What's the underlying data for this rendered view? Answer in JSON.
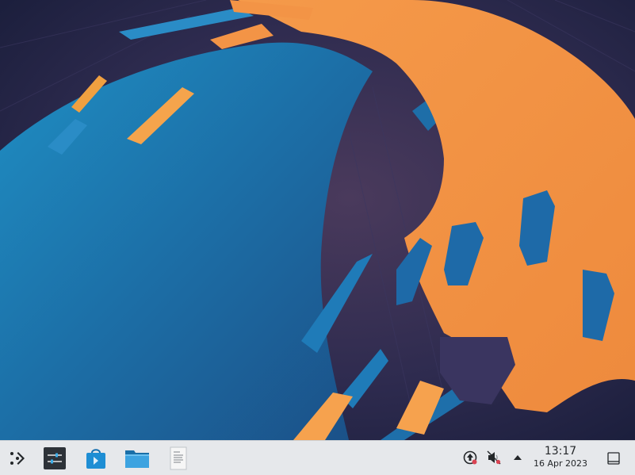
{
  "desktop": {
    "wallpaper": "kde-plasma-flow-wallpaper",
    "colors": {
      "background": "#23264a",
      "blue": "#1d6fa6",
      "orange": "#f08a3e",
      "orange_light": "#f5a04c"
    }
  },
  "panel": {
    "background": "#e6e8eb",
    "launcher": {
      "icon": "kde-application-launcher-icon"
    },
    "tasks": [
      {
        "icon": "system-settings-icon",
        "color": "#2d3238"
      },
      {
        "icon": "discover-store-icon",
        "color": "#1e8ed4"
      },
      {
        "icon": "dolphin-folder-icon",
        "color": "#2a8fd2"
      },
      {
        "icon": "text-document-icon",
        "color": "#f4f4f4"
      }
    ],
    "tray": {
      "items": [
        {
          "icon": "update-notifier-icon"
        },
        {
          "icon": "volume-muted-icon"
        },
        {
          "icon": "tray-expand-arrow-icon"
        }
      ]
    },
    "clock": {
      "time": "13:17",
      "date": "16 Apr 2023"
    },
    "show_desktop": {
      "icon": "show-desktop-icon"
    }
  }
}
